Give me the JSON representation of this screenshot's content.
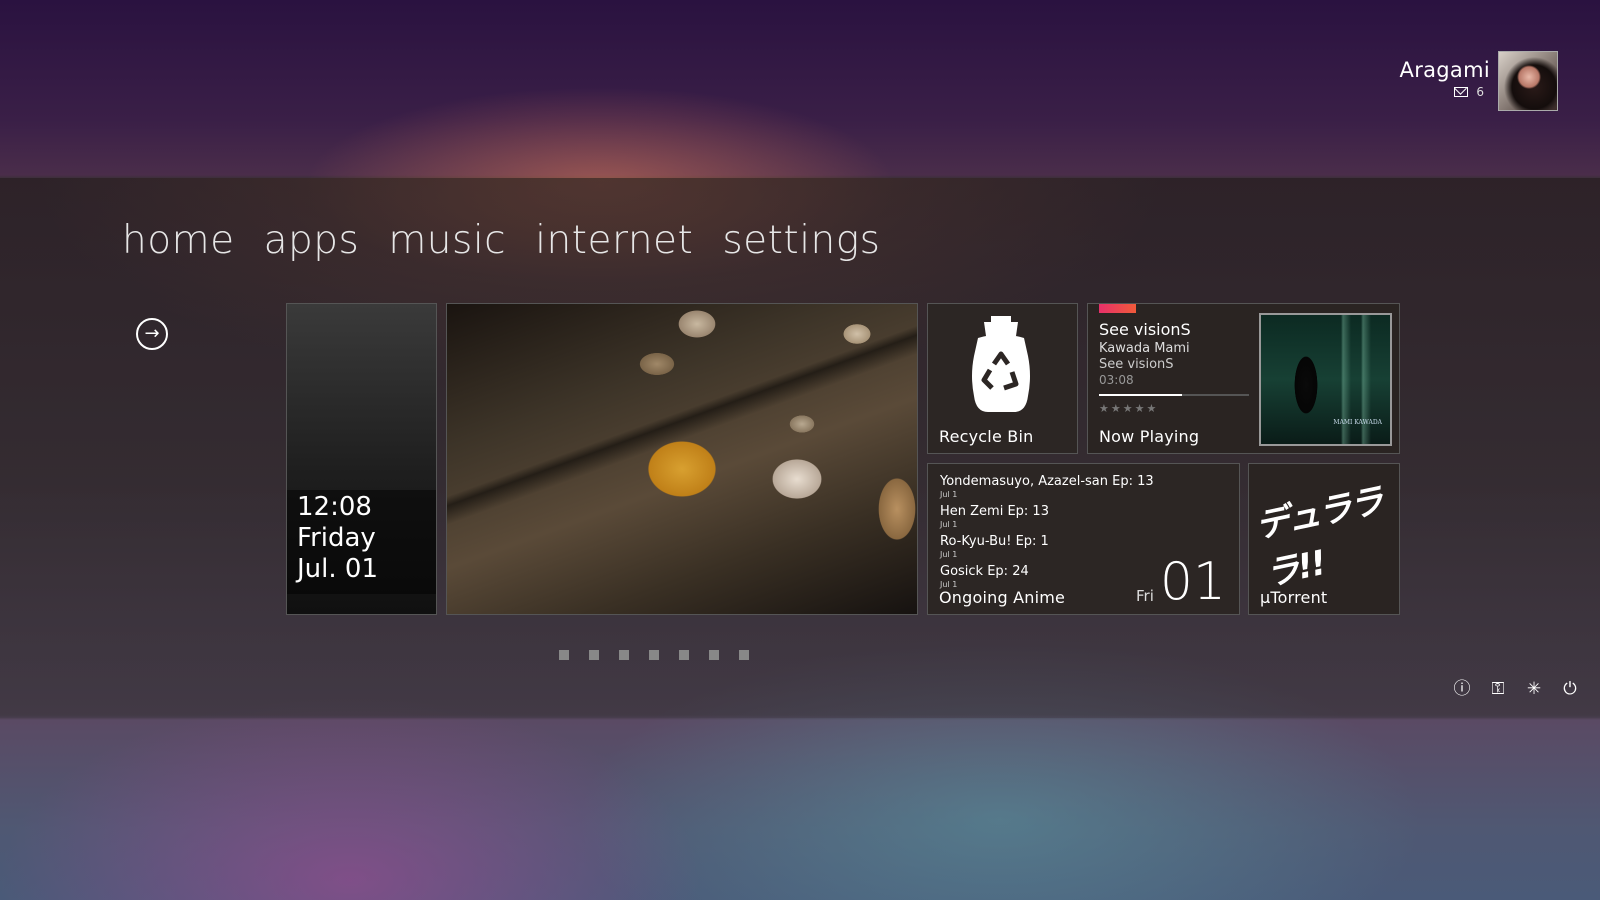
{
  "user": {
    "name": "Aragami",
    "mail_count": "6"
  },
  "nav": {
    "items": [
      "home",
      "apps",
      "music",
      "internet",
      "settings"
    ]
  },
  "clock_tile": {
    "time": "12:08",
    "day": "Friday",
    "date": "Jul. 01"
  },
  "recycle_tile": {
    "label": "Recycle Bin"
  },
  "music_tile": {
    "song": "See visionS",
    "artist": "Kawada Mami",
    "album": "See visionS",
    "duration": "03:08",
    "progress": 0.55,
    "stars": "★★★★★",
    "label": "Now Playing",
    "album_caption": "MAMI KAWADA"
  },
  "anime_tile": {
    "items": [
      {
        "title": "Yondemasuyo, Azazel-san Ep: 13",
        "date": "Jul 1"
      },
      {
        "title": "Hen Zemi Ep: 13",
        "date": "Jul 1"
      },
      {
        "title": "Ro-Kyu-Bu! Ep: 1",
        "date": "Jul 1"
      },
      {
        "title": "Gosick Ep: 24",
        "date": "Jul 1"
      }
    ],
    "label": "Ongoing Anime",
    "day_name": "Fri",
    "day_number": "01"
  },
  "torrent_tile": {
    "art_text": "デュラララ!!",
    "label": "µTorrent"
  },
  "page_dots": 7,
  "system_icons": [
    "info-icon",
    "key-icon",
    "loading-icon",
    "power-icon"
  ],
  "colors": {
    "accent": "#e6306a"
  }
}
